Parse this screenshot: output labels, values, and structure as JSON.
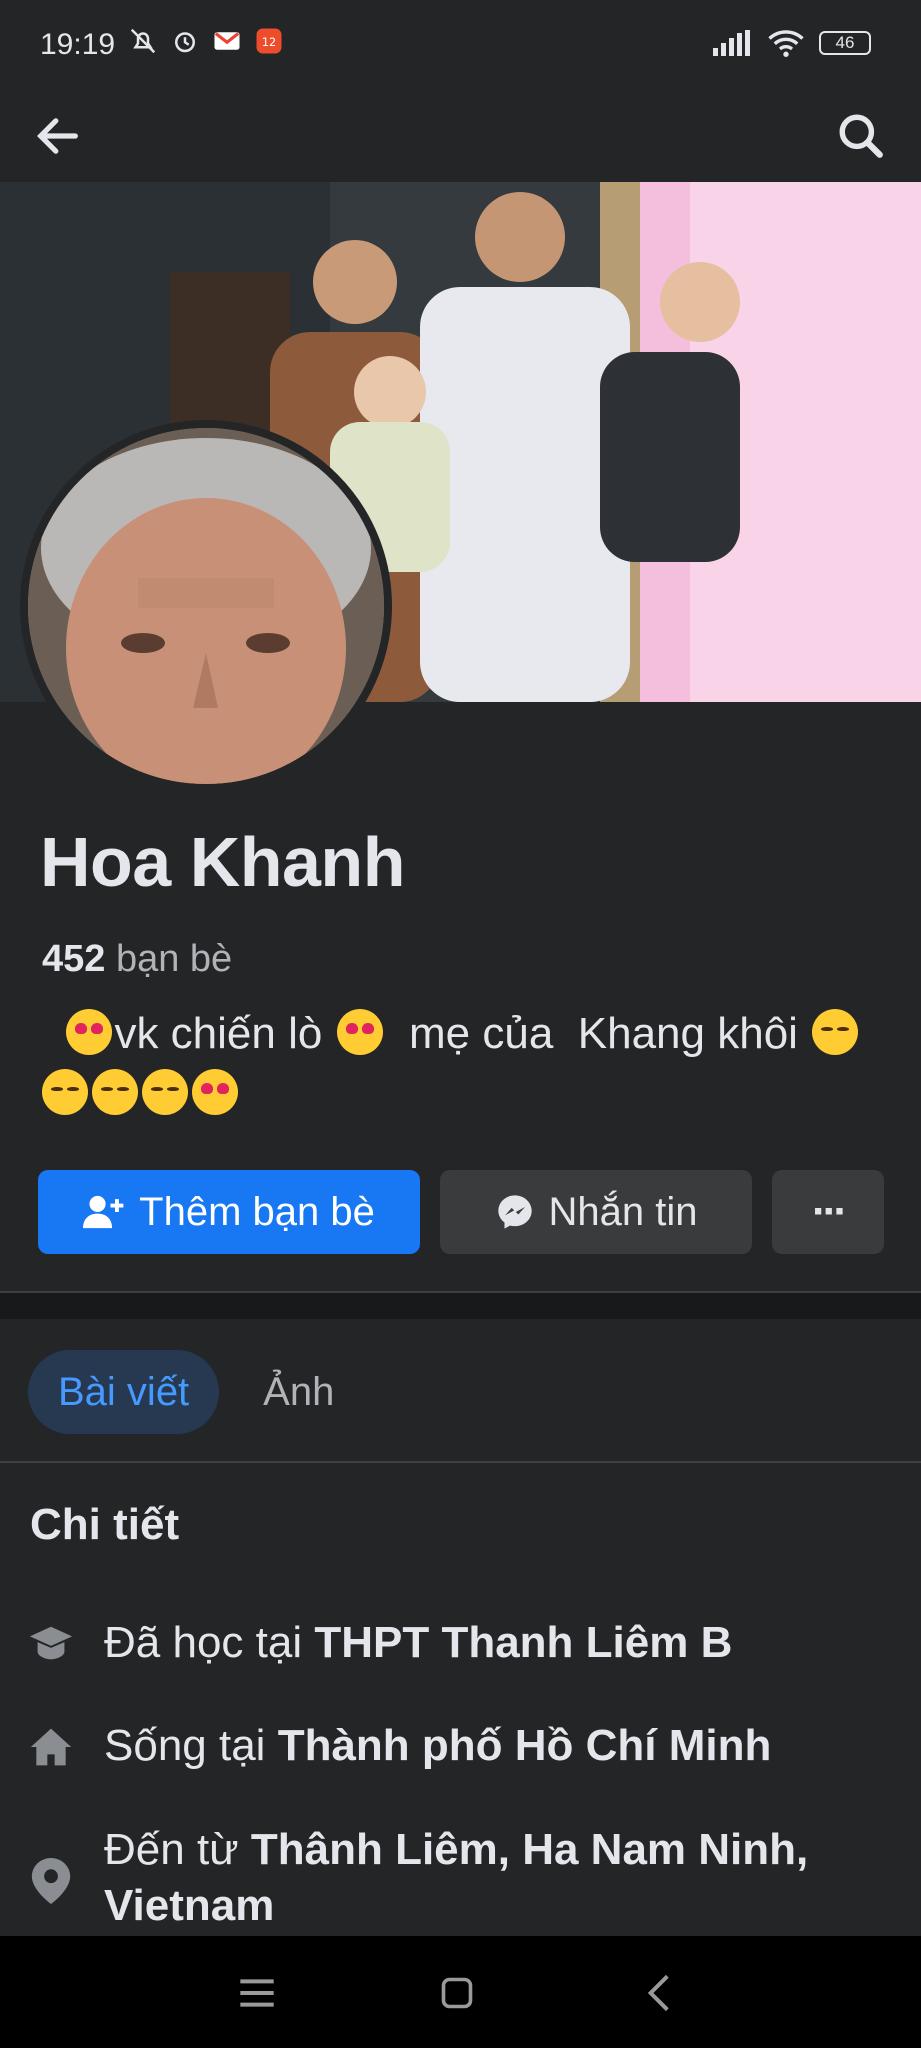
{
  "status_bar": {
    "time": "19:19",
    "battery": "46"
  },
  "profile": {
    "name": "Hoa Khanh",
    "friends_count": "452",
    "friends_label": "bạn bè",
    "bio_part1": "vk chiến lò",
    "bio_part2": "  mẹ của  Khang khôi"
  },
  "actions": {
    "add_friend": "Thêm bạn bè",
    "message": "Nhắn tin",
    "more": "···"
  },
  "tabs": [
    {
      "label": "Bài viết",
      "active": true
    },
    {
      "label": "Ảnh",
      "active": false
    }
  ],
  "details": {
    "title": "Chi tiết",
    "studied_prefix": "Đã học tại",
    "studied_value": "THPT Thanh Liêm B",
    "lives_prefix": "Sống tại",
    "lives_value": "Thành phố Hồ Chí Minh",
    "from_prefix": "Đến từ",
    "from_value": "Thânh Liêm, Ha Nam Ninh, Vietnam"
  },
  "colors": {
    "background": "#242526",
    "primary_button": "#1877f2",
    "secondary_button": "#3a3b3c",
    "active_tab_bg": "#263951",
    "active_tab_text": "#4599ff"
  },
  "icons": [
    "back-arrow-icon",
    "search-icon",
    "add-friend-icon",
    "messenger-icon",
    "more-icon",
    "education-icon",
    "home-icon",
    "location-pin-icon",
    "menu-icon",
    "home-square-icon",
    "back-chevron-icon"
  ]
}
